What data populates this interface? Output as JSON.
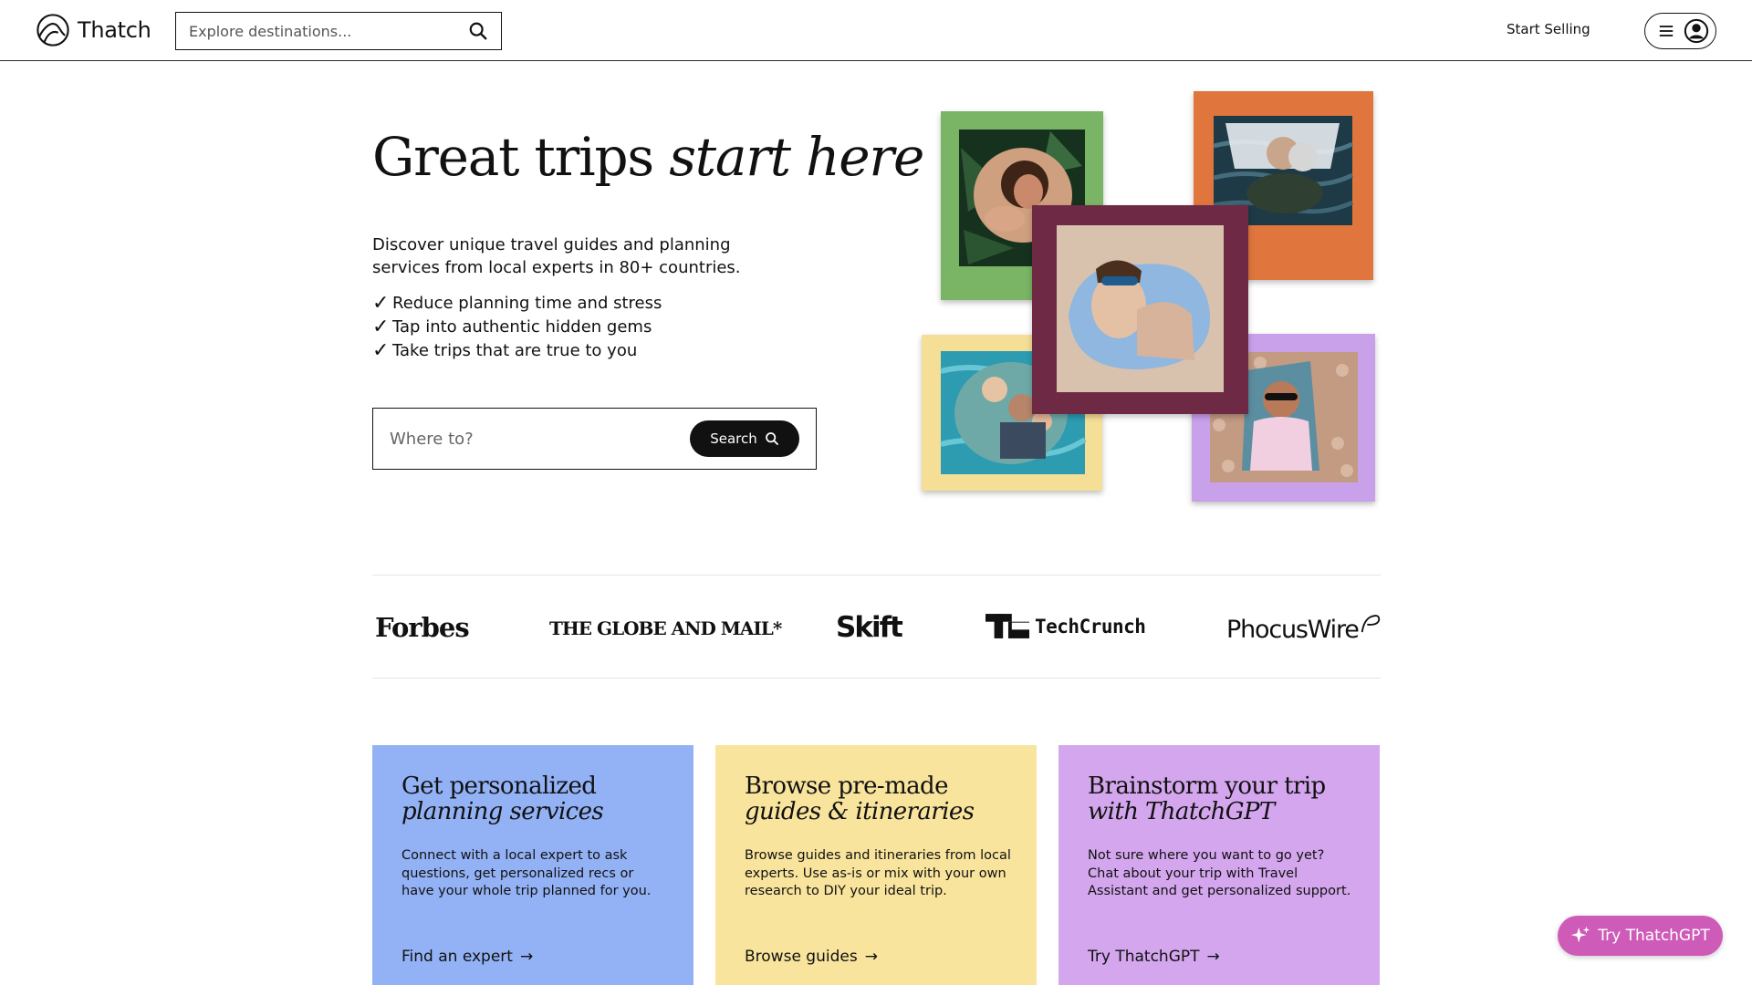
{
  "header": {
    "brand": "Thatch",
    "search_placeholder": "Explore destinations...",
    "start_selling": "Start Selling",
    "icons": [
      "thatch-logo-icon",
      "search-icon",
      "hamburger-menu-icon",
      "user-avatar-icon"
    ]
  },
  "hero": {
    "title_plain": "Great trips",
    "title_italic": "start here",
    "description": "Discover unique travel guides and planning services from local experts in 80+ countries.",
    "benefits": [
      "Reduce planning time and stress",
      "Tap into authentic hidden gems",
      "Take trips that are true to you"
    ],
    "search_placeholder": "Where to?",
    "search_button": "Search"
  },
  "collage": {
    "frames": [
      {
        "name": "green",
        "color": "#79b565"
      },
      {
        "name": "orange",
        "color": "#e0763e"
      },
      {
        "name": "maroon",
        "color": "#6e2a45"
      },
      {
        "name": "yellow",
        "color": "#f5df97"
      },
      {
        "name": "lavender",
        "color": "#c9a0ea"
      }
    ]
  },
  "press": {
    "forbes": "Forbes",
    "globe": "THE GLOBE AND MAIL*",
    "skift": "Skift",
    "techcrunch": "TechCrunch",
    "phocuswire": "PhocusWire"
  },
  "cards": [
    {
      "title_line1": "Get personalized",
      "title_line2": "planning services",
      "body": "Connect with a local expert to ask questions, get personalized recs or have your whole trip planned for you.",
      "link": "Find an expert",
      "color": "#93b2f5"
    },
    {
      "title_line1": "Browse pre-made",
      "title_line2": "guides & itineraries",
      "body": "Browse guides and itineraries from local experts. Use as-is or mix with your own research to DIY your ideal trip.",
      "link": "Browse guides",
      "color": "#f8e49c"
    },
    {
      "title_line1": "Brainstorm your trip",
      "title_line2": "with ThatchGPT",
      "body": "Not sure where you want to go yet? Chat about your trip with Travel Assistant and get personalized support.",
      "link": "Try ThatchGPT",
      "color": "#d4a6ee"
    }
  ],
  "fab": {
    "label": "Try ThatchGPT"
  }
}
